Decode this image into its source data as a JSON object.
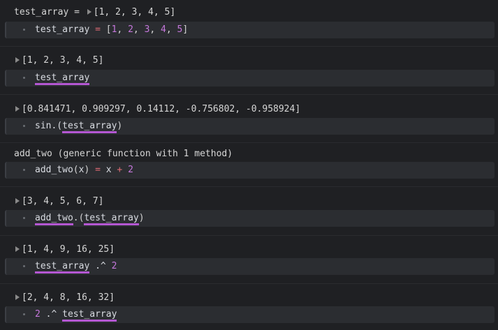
{
  "cells": [
    {
      "output_prefix": "test_array = ",
      "output_value": "[1, 2, 3, 4, 5]",
      "code": {
        "var": "test_array",
        "eq": " = ",
        "lb": "[",
        "nums": [
          "1",
          "2",
          "3",
          "4",
          "5"
        ],
        "rb": "]"
      }
    },
    {
      "output_value": "[1, 2, 3, 4, 5]",
      "code": {
        "ref": "test_array"
      }
    },
    {
      "output_value": "[0.841471, 0.909297, 0.14112, -0.756802, -0.958924]",
      "code": {
        "fn": "sin.(",
        "ref": "test_array",
        "close": ")"
      }
    },
    {
      "output_text": "add_two (generic function with 1 method)",
      "code": {
        "fn": "add_two",
        "lp": "(",
        "arg": "x",
        "rp": ")",
        "eq": " = ",
        "body_var": "x",
        "plus": " + ",
        "num": "2"
      }
    },
    {
      "output_value": "[3, 4, 5, 6, 7]",
      "code": {
        "ref1": "add_two",
        "dot": ".(",
        "ref2": "test_array",
        "close": ")"
      }
    },
    {
      "output_value": "[1, 4, 9, 16, 25]",
      "code": {
        "ref": "test_array",
        "op": " .^ ",
        "num": "2"
      }
    },
    {
      "output_value": "[2, 4, 8, 16, 32]",
      "code": {
        "num": "2",
        "op": " .^ ",
        "ref": "test_array"
      }
    }
  ],
  "icons": {
    "expand": "triangle-right-icon",
    "cell_handle": "drag-dot-icon"
  },
  "colors": {
    "background": "#1f2023",
    "cell_background": "#2b2d31",
    "reference_underline": "#b457d2",
    "number": "#c678dd",
    "operator": "#e06c75"
  }
}
